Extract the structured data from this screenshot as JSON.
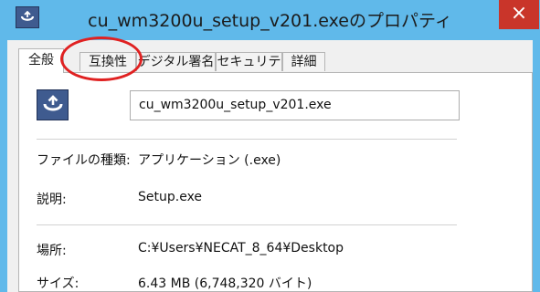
{
  "window": {
    "title": "cu_wm3200u_setup_v201.exeのプロパティ",
    "close_label": "×"
  },
  "tabs": [
    {
      "label": "全般",
      "active": true
    },
    {
      "label": "互換性",
      "active": false
    },
    {
      "label": "デジタル署名",
      "active": false
    },
    {
      "label": "セキュリティ",
      "active": false
    },
    {
      "label": "詳細",
      "active": false
    }
  ],
  "general": {
    "file_name": "cu_wm3200u_setup_v201.exe",
    "file_type_label": "ファイルの種類:",
    "file_type_value": "アプリケーション (.exe)",
    "description_label": "説明:",
    "description_value": "Setup.exe",
    "location_label": "場所:",
    "location_value": "C:¥Users¥NECAT_8_64¥Desktop",
    "size_label": "サイズ:",
    "size_value": "6.43 MB (6,748,320 バイト)"
  },
  "annotation": {
    "shape": "ellipse",
    "color": "#e02121",
    "highlights": "互換性"
  },
  "colors": {
    "titlebar": "#60b9ea",
    "close_button": "#c9352a"
  }
}
